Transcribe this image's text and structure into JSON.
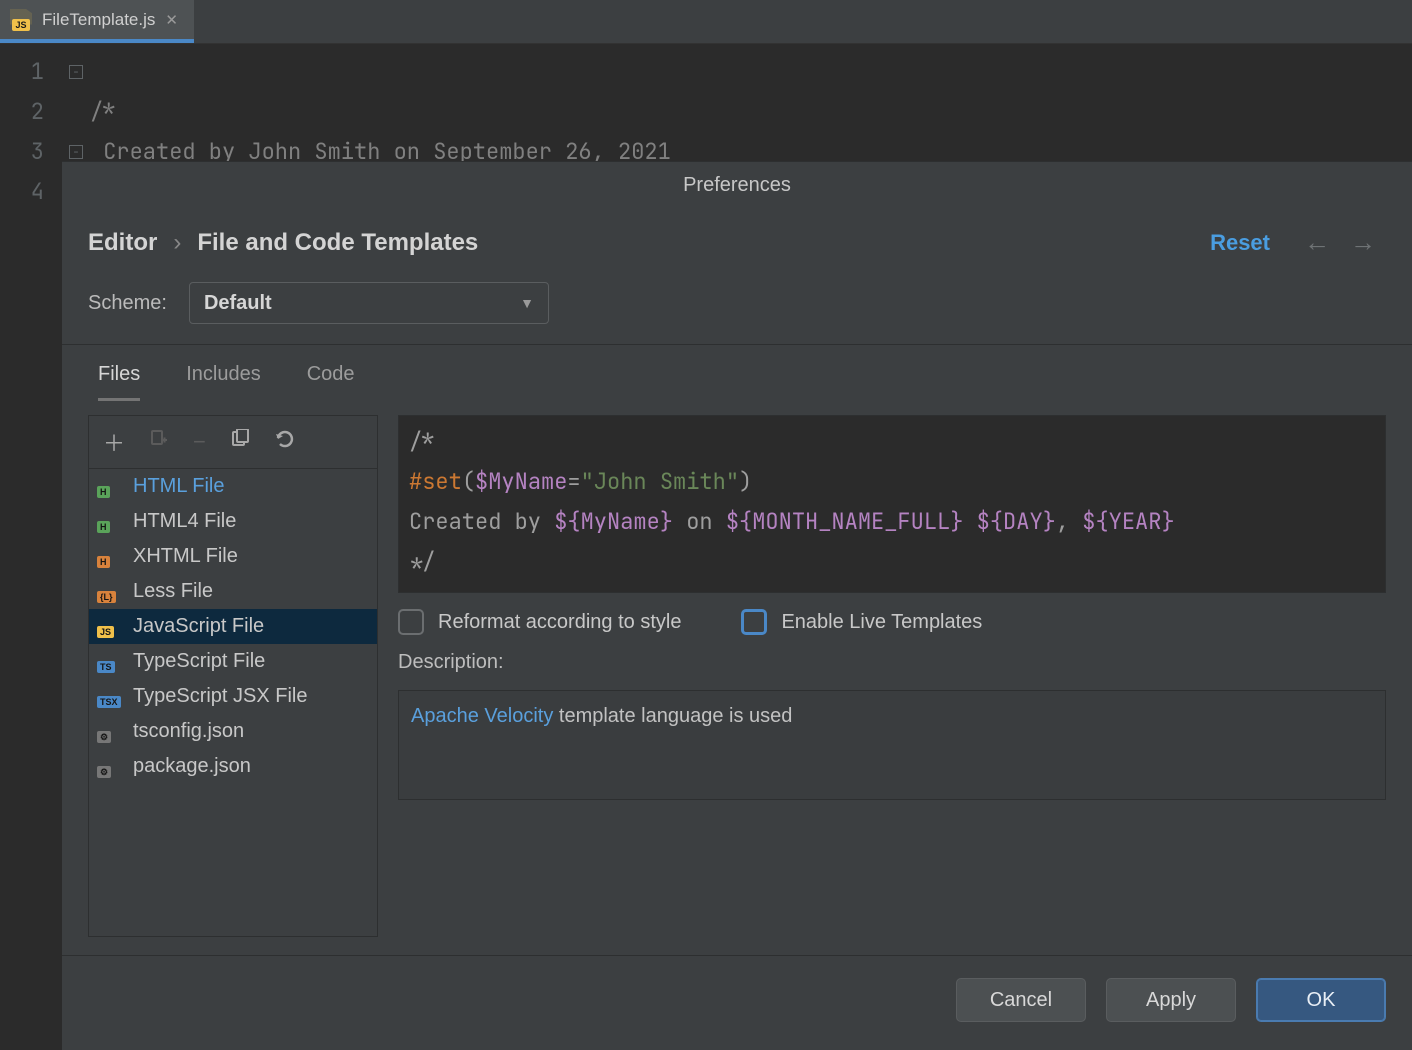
{
  "editor_tab": {
    "filename": "FileTemplate.js",
    "badge": "JS"
  },
  "editor_lines": {
    "l1": "/*",
    "l2": " Created by John Smith on September 26, 2021",
    "l3": "*/",
    "l4": ""
  },
  "dialog": {
    "title": "Preferences",
    "breadcrumb": {
      "root": "Editor",
      "leaf": "File and Code Templates"
    },
    "reset": "Reset",
    "scheme_label": "Scheme:",
    "scheme_value": "Default",
    "tabs": {
      "files": "Files",
      "includes": "Includes",
      "code": "Code"
    },
    "toolbar": {
      "add": "+",
      "addfrom": "addfrom",
      "remove": "−",
      "copy": "copy",
      "undo": "undo"
    },
    "templates": [
      {
        "label": "HTML File",
        "badge": "H",
        "cls": "tag-h",
        "link": true
      },
      {
        "label": "HTML4 File",
        "badge": "H",
        "cls": "tag-h"
      },
      {
        "label": "XHTML File",
        "badge": "H",
        "cls": "tag-ho"
      },
      {
        "label": "Less File",
        "badge": "{L}",
        "cls": "tag-l"
      },
      {
        "label": "JavaScript File",
        "badge": "JS",
        "cls": "tag-js",
        "selected": true
      },
      {
        "label": "TypeScript File",
        "badge": "TS",
        "cls": "tag-ts"
      },
      {
        "label": "TypeScript JSX File",
        "badge": "TSX",
        "cls": "tag-tsx"
      },
      {
        "label": "tsconfig.json",
        "badge": "⚙",
        "cls": "tag-gear"
      },
      {
        "label": "package.json",
        "badge": "⚙",
        "cls": "tag-gear"
      }
    ],
    "template_code": {
      "line1": "/*",
      "line2a": "#set",
      "line2b": "(",
      "line2c": "$MyName",
      "line2d": "=",
      "line2e": "\"John Smith\"",
      "line2f": ")",
      "line3a": "Created by ",
      "line3b": "${MyName}",
      "line3c": " on ",
      "line3d": "${MONTH_NAME_FULL}",
      "line3e": " ",
      "line3f": "${DAY}",
      "line3g": ", ",
      "line3h": "${YEAR}",
      "line4": "*/"
    },
    "check_reformat": "Reformat according to style",
    "check_live": "Enable Live Templates",
    "description_label": "Description:",
    "description_link": "Apache Velocity",
    "description_rest": " template language is used",
    "buttons": {
      "cancel": "Cancel",
      "apply": "Apply",
      "ok": "OK"
    }
  }
}
